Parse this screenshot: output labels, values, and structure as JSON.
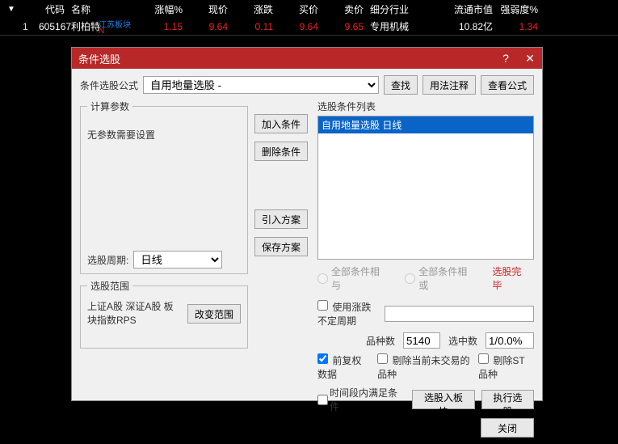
{
  "table": {
    "headers": {
      "arrow": "▼",
      "code": "代码",
      "name": "名称",
      "pct": "涨幅%",
      "price": "现价",
      "chg": "涨跌",
      "bid": "买价",
      "ask": "卖价",
      "industry": "细分行业",
      "mcap": "流通市值",
      "strength": "强弱度%"
    },
    "row": {
      "idx": "1",
      "code": "605167",
      "name": "利柏特",
      "tag": "江苏板块",
      "tagN": "N",
      "pct": "1.15",
      "price": "9.64",
      "chg": "0.11",
      "bid": "9.64",
      "ask": "9.65",
      "industry": "专用机械",
      "mcap": "10.82亿",
      "strength": "1.34"
    }
  },
  "dialog": {
    "title": "条件选股",
    "formula_label": "条件选股公式",
    "formula_value": "自用地量选股 -",
    "find_btn": "查找",
    "usage_btn": "用法注释",
    "view_btn": "查看公式",
    "fs_params": "计算参数",
    "no_params_msg": "无参数需要设置",
    "period_label": "选股周期:",
    "period_value": "日线",
    "fs_scope": "选股范围",
    "scope_text": "上证A股 深证A股 板块指数RPS",
    "scope_btn": "改变范围",
    "mid": {
      "add": "加入条件",
      "del": "删除条件",
      "import": "引入方案",
      "save": "保存方案"
    },
    "cond_list_label": "选股条件列表",
    "cond_item": "自用地量选股 日线",
    "radio_and": "全部条件相与",
    "radio_or": "全部条件相或",
    "done_text": "选股完毕",
    "use_period_chk": "使用涨跌不定周期",
    "species_label": "品种数",
    "species_val": "5140",
    "selected_label": "选中数",
    "selected_val": "1/0.0%",
    "pre_adj": "前复权数据",
    "del_notrade": "剔除当前未交易的品种",
    "del_st": "剔除ST品种",
    "time_cond": "时间段内满足条件",
    "to_block": "选股入板块",
    "exec": "执行选股",
    "close": "关闭"
  }
}
